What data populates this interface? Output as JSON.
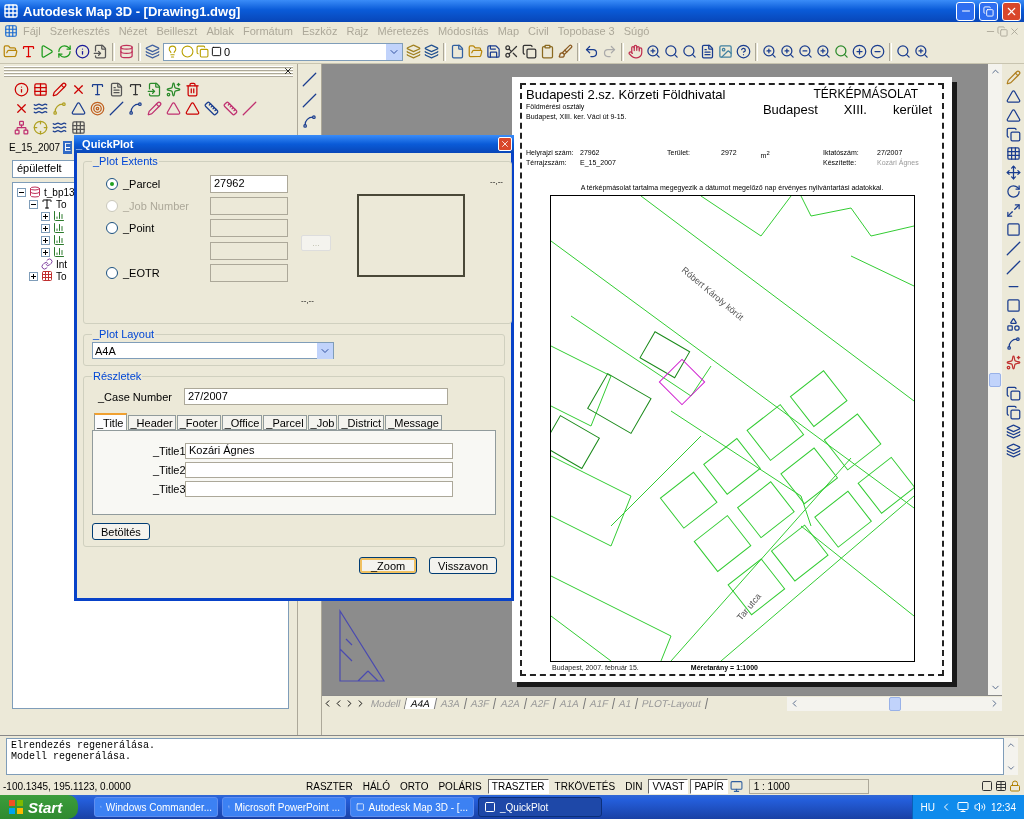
{
  "window": {
    "title": "Autodesk Map 3D - [Drawing1.dwg]"
  },
  "menu": [
    {
      "label": "Fájl",
      "disabled": true
    },
    {
      "label": "Szerkesztés",
      "disabled": true
    },
    {
      "label": "Nézet",
      "disabled": true
    },
    {
      "label": "Beilleszt",
      "disabled": true
    },
    {
      "label": "Ablak",
      "disabled": true
    },
    {
      "label": "Formátum",
      "disabled": true
    },
    {
      "label": "Eszköz",
      "disabled": true
    },
    {
      "label": "Rajz",
      "disabled": true
    },
    {
      "label": "Méretezés",
      "disabled": true
    },
    {
      "label": "Módosítás",
      "disabled": true
    },
    {
      "label": "Map",
      "disabled": true
    },
    {
      "label": "Civil",
      "disabled": true
    },
    {
      "label": "Topobase 3",
      "disabled": true
    },
    {
      "label": "Súgó",
      "disabled": true
    }
  ],
  "layer": {
    "value": "0"
  },
  "left_panel": {
    "tabs": [
      {
        "label": "E_15_2007",
        "selected": false
      },
      {
        "label": "E",
        "selected": true
      }
    ],
    "filter": {
      "value": "épületfelt"
    },
    "tree": [
      {
        "label": "t_bp13",
        "kind": "database",
        "expanded": true,
        "children": [
          {
            "label": "To",
            "kind": "text",
            "expanded": true,
            "children": [
              {
                "kind": "bars",
                "expanded": false
              },
              {
                "kind": "bars",
                "expanded": false
              },
              {
                "kind": "bars",
                "expanded": false
              },
              {
                "kind": "bars",
                "expanded": false
              }
            ]
          },
          {
            "label": "Int",
            "kind": "link"
          },
          {
            "label": "To",
            "kind": "grid",
            "expanded": false
          }
        ]
      }
    ]
  },
  "canvas": {
    "layout_tabs": [
      {
        "label": "Modell",
        "selected": false
      },
      {
        "label": "A4A",
        "selected": true
      },
      {
        "label": "A3A",
        "selected": false
      },
      {
        "label": "A3F",
        "selected": false
      },
      {
        "label": "A2A",
        "selected": false
      },
      {
        "label": "A2F",
        "selected": false
      },
      {
        "label": "A1A",
        "selected": false
      },
      {
        "label": "A1F",
        "selected": false
      },
      {
        "label": "A1",
        "selected": false
      },
      {
        "label": "PLOT-Layout",
        "selected": false
      }
    ],
    "sheet": {
      "office": "Budapesti 2.sz. Körzeti Földhivatal",
      "department": "Földmérési osztály",
      "address": "Budapest, XIII. ker. Váci út 9-15.",
      "doc_title": "TÉRKÉPMÁSOLAT",
      "district": [
        "Budapest",
        "XIII.",
        "kerület"
      ],
      "left_fields": [
        {
          "label": "Helyrajzi szám:",
          "value": "27962"
        },
        {
          "label": "Térrajzszám:",
          "value": "E_15_2007"
        }
      ],
      "area": {
        "label": "Terület:",
        "value": "2972",
        "unit": "m$^{2}$"
      },
      "right_fields": [
        {
          "label": "Iktatószám:",
          "value": "27/2007"
        },
        {
          "label": "Készítette:",
          "value": "Kozári Ágnes"
        }
      ],
      "statement": "A térképmásolat tartalma megegyezik a dátumot megelőző nap érvényes nyilvántartási adatokkal.",
      "map_labels": [
        "Róbert Károly körút",
        "Tar utca"
      ],
      "date": "Budapest, 2007. február 15.",
      "scale": "Méretarány = 1:1000"
    }
  },
  "dialog": {
    "title": "_QuickPlot",
    "plot_extents": {
      "legend": "_Plot Extents",
      "options": [
        {
          "label": "_Parcel",
          "selected": true,
          "disabled": false,
          "inputs": [
            {
              "value": "27962",
              "disabled": false
            }
          ]
        },
        {
          "label": "_Job Number",
          "selected": false,
          "disabled": true,
          "inputs": [
            {
              "disabled": true
            }
          ]
        },
        {
          "label": "_Point",
          "selected": false,
          "disabled": false,
          "inputs": [
            {
              "disabled": true
            },
            {
              "disabled": true
            }
          ]
        },
        {
          "label": "_EOTR",
          "selected": false,
          "disabled": false,
          "inputs": [
            {
              "disabled": true
            }
          ]
        }
      ],
      "browse_button": {
        "label": "...",
        "disabled": true
      },
      "hints": [
        "--,--",
        "--,--"
      ]
    },
    "plot_layout": {
      "legend": "_Plot Layout",
      "value": "A4A"
    },
    "details": {
      "legend": "Részletek",
      "case_label": "_Case Number",
      "case_value": "27/2007",
      "tabs": [
        {
          "label": "_Title",
          "selected": true
        },
        {
          "label": "_Header",
          "selected": false
        },
        {
          "label": "_Footer",
          "selected": false
        },
        {
          "label": "_Office",
          "selected": false
        },
        {
          "label": "_Parcel",
          "selected": false
        },
        {
          "label": "_Job",
          "selected": false
        },
        {
          "label": "_District",
          "selected": false
        },
        {
          "label": "_Message",
          "selected": false
        }
      ],
      "fields": [
        {
          "label": "_Title1",
          "value": "Kozári Ágnes"
        },
        {
          "label": "_Title2"
        },
        {
          "label": "_Title3"
        }
      ],
      "load_button": "Betöltés"
    },
    "buttons": [
      {
        "label": "_Zoom",
        "default": true
      },
      {
        "label": "Visszavon",
        "default": false
      }
    ]
  },
  "command_lines": [
    "Elrendezés regenerálása.",
    "Modell regenerálása."
  ],
  "status_bar": {
    "coordinates": "-100.1345, 195.1123, 0.0000",
    "toggles": [
      {
        "label": "RASZTER",
        "on": false
      },
      {
        "label": "HÁLÓ",
        "on": false
      },
      {
        "label": "ORTO",
        "on": false
      },
      {
        "label": "POLÁRIS",
        "on": false
      },
      {
        "label": "TRASZTER",
        "on": true
      },
      {
        "label": "TRKÖVETÉS",
        "on": false
      },
      {
        "label": "DIN",
        "on": false
      },
      {
        "label": "VVAST",
        "on": true
      },
      {
        "label": "PAPÍR",
        "on": true
      }
    ],
    "scale": "1 : 1000"
  },
  "taskbar": {
    "start": "Start",
    "tasks": [
      {
        "label": "Windows Commander...",
        "selected": false
      },
      {
        "label": "Microsoft PowerPoint ...",
        "selected": false
      },
      {
        "label": "Autodesk Map 3D - [...",
        "selected": false
      },
      {
        "label": "_QuickPlot",
        "selected": true
      }
    ],
    "language": "HU",
    "clock": "12:34"
  }
}
